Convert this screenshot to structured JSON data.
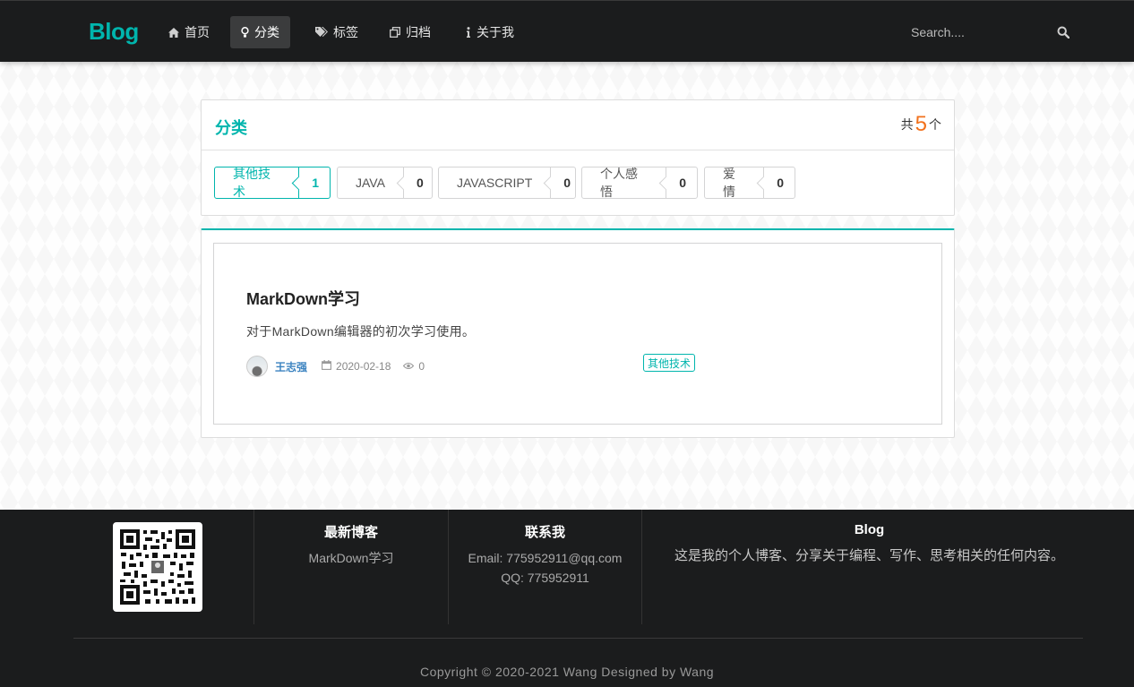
{
  "header": {
    "brand": "Blog",
    "nav": [
      {
        "label": "首页",
        "icon": "home-icon"
      },
      {
        "label": "分类",
        "icon": "idea-icon",
        "active": true
      },
      {
        "label": "标签",
        "icon": "tags-icon"
      },
      {
        "label": "归档",
        "icon": "clone-icon"
      },
      {
        "label": "关于我",
        "icon": "info-icon"
      }
    ],
    "search_placeholder": "Search...."
  },
  "categories": {
    "title": "分类",
    "count_prefix": "共",
    "count": "5",
    "count_suffix": "个",
    "items": [
      {
        "name": "其他技术",
        "count": "1",
        "active": true
      },
      {
        "name": "JAVA",
        "count": "0"
      },
      {
        "name": "JAVASCRIPT",
        "count": "0"
      },
      {
        "name": "个人感悟",
        "count": "0"
      },
      {
        "name": "爱情",
        "count": "0"
      }
    ]
  },
  "posts": [
    {
      "title": "MarkDown学习",
      "description": "对于MarkDown编辑器的初次学习使用。",
      "author": "王志强",
      "date": "2020-02-18",
      "views": "0",
      "tag": "其他技术"
    }
  ],
  "footer": {
    "latest": {
      "title": "最新博客",
      "items": [
        "MarkDown学习"
      ]
    },
    "contact": {
      "title": "联系我",
      "email": "Email: 775952911@qq.com",
      "qq": "QQ: 775952911"
    },
    "about": {
      "title": "Blog",
      "text": "这是我的个人博客、分享关于编程、写作、思考相关的任何内容。"
    },
    "copyright": "Copyright © 2020-2021 Wang Designed by Wang"
  },
  "colors": {
    "accent": "#00b5ad",
    "count_highlight": "#f2711c",
    "dark": "#1b1c1d"
  }
}
